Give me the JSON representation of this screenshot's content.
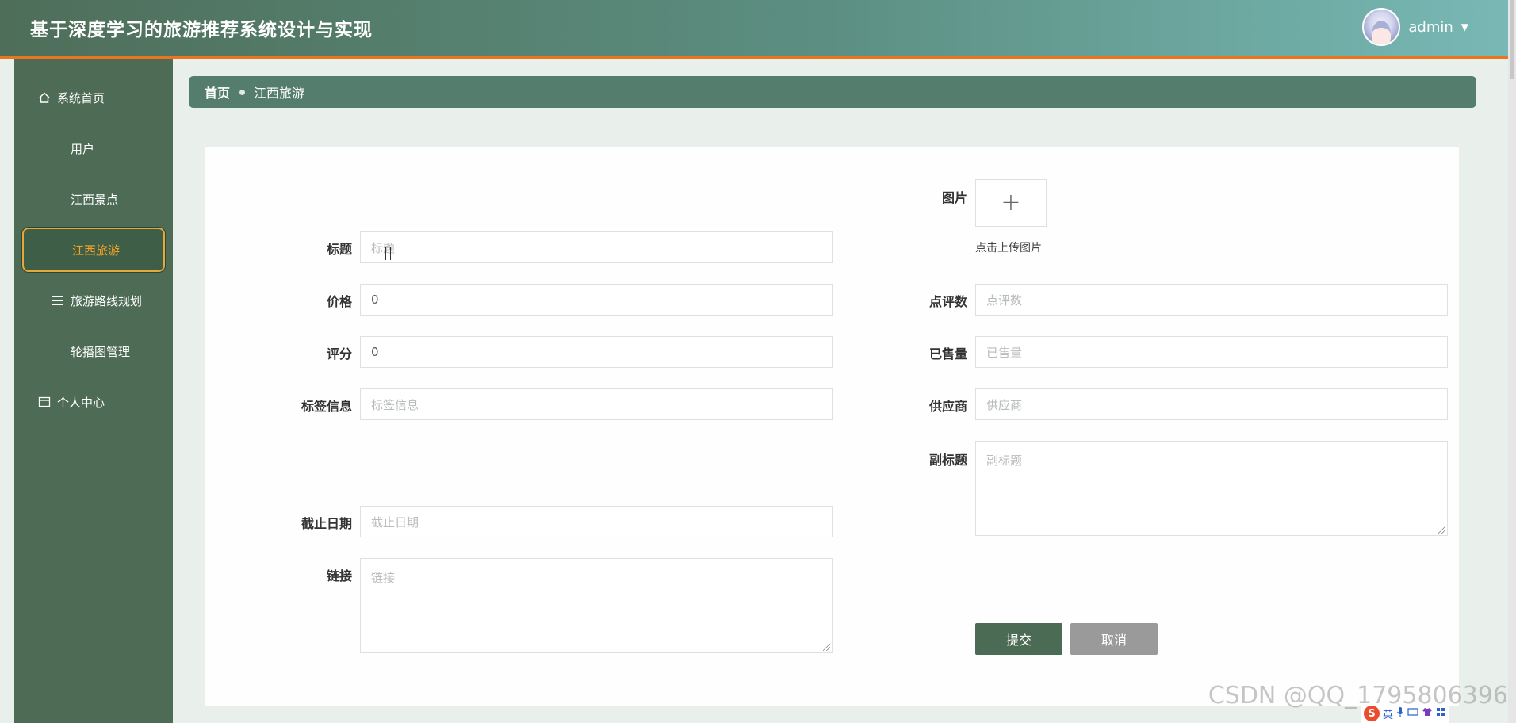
{
  "header": {
    "title": "基于深度学习的旅游推荐系统设计与实现",
    "username": "admin",
    "caret": "▼"
  },
  "sidebar": {
    "items": [
      {
        "label": "系统首页",
        "icon": "home-icon"
      },
      {
        "label": "用户",
        "icon": "grid-icon"
      },
      {
        "label": "江西景点",
        "icon": "grid-icon"
      },
      {
        "label": "江西旅游",
        "icon": "grid-icon",
        "active": true
      },
      {
        "label": "旅游路线规划",
        "icon": "list-icon"
      },
      {
        "label": "轮播图管理",
        "icon": "grid-icon"
      },
      {
        "label": "个人中心",
        "icon": "card-icon"
      }
    ],
    "active_color": "#f4a32a"
  },
  "breadcrumb": {
    "home": "首页",
    "current": "江西旅游"
  },
  "form": {
    "title": {
      "label": "标题",
      "placeholder": "标题",
      "value": ""
    },
    "price": {
      "label": "价格",
      "value": "0"
    },
    "rating": {
      "label": "评分",
      "value": "0"
    },
    "tags": {
      "label": "标签信息",
      "placeholder": "标签信息"
    },
    "deadline": {
      "label": "截止日期",
      "placeholder": "截止日期"
    },
    "link": {
      "label": "链接",
      "placeholder": "链接"
    },
    "image": {
      "label": "图片",
      "upload_tip": "点击上传图片",
      "plus": "+"
    },
    "review_count": {
      "label": "点评数",
      "placeholder": "点评数"
    },
    "sold": {
      "label": "已售量",
      "placeholder": "已售量"
    },
    "supplier": {
      "label": "供应商",
      "placeholder": "供应商"
    },
    "subtitle": {
      "label": "副标题",
      "placeholder": "副标题"
    },
    "submit_label": "提交",
    "cancel_label": "取消"
  },
  "watermark": "CSDN @QQ_1795806396",
  "taskbar": {
    "ime_logo": "S",
    "ime_lang": "英"
  },
  "colors": {
    "header_start": "#4e6e59",
    "header_end": "#78b8b5",
    "header_border": "#e7761f",
    "sidebar_bg": "#4d6b55",
    "submit_bg": "#4c6b55",
    "cancel_bg": "#9a9a9a"
  }
}
